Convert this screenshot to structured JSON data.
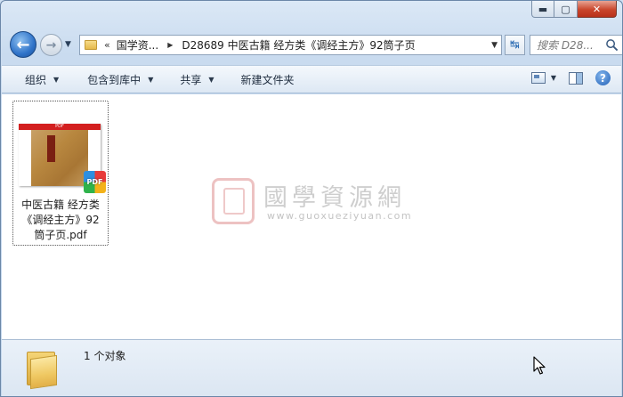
{
  "window": {
    "caption_buttons": {
      "minimize": "▬",
      "maximize": "▢",
      "close": "✕"
    }
  },
  "nav": {
    "back_glyph": "←",
    "forward_glyph": "→",
    "dropdown_glyph": "▼"
  },
  "address": {
    "overflow": "«",
    "crumbs": [
      "国学资...",
      "D28689 中医古籍 经方类《调经主方》92筒子页"
    ],
    "separator": "▶",
    "dropdown_glyph": "▼"
  },
  "refresh": {
    "glyph": "↹"
  },
  "search": {
    "placeholder": "搜索 D28..."
  },
  "toolbar": {
    "organize": "组织",
    "include_library": "包含到库中",
    "share": "共享",
    "new_folder": "新建文件夹",
    "dropdown_glyph": "▼",
    "help_glyph": "?"
  },
  "files": [
    {
      "name": "中医古籍 经方类《调经主方》92筒子页.pdf",
      "name_lines": [
        "中医古籍 经方类",
        "《调经主方》92",
        "筒子页.pdf"
      ],
      "thumb_bar_text": "PDF",
      "badge": "PDF"
    }
  ],
  "watermark": {
    "title": "國學資源網",
    "url": "www.guoxueziyuan.com"
  },
  "status": {
    "count_text": "1 个对象"
  },
  "colors": {
    "accent": "#2f73c9",
    "close": "#c9462c",
    "pdf_red": "#d31f1f"
  }
}
